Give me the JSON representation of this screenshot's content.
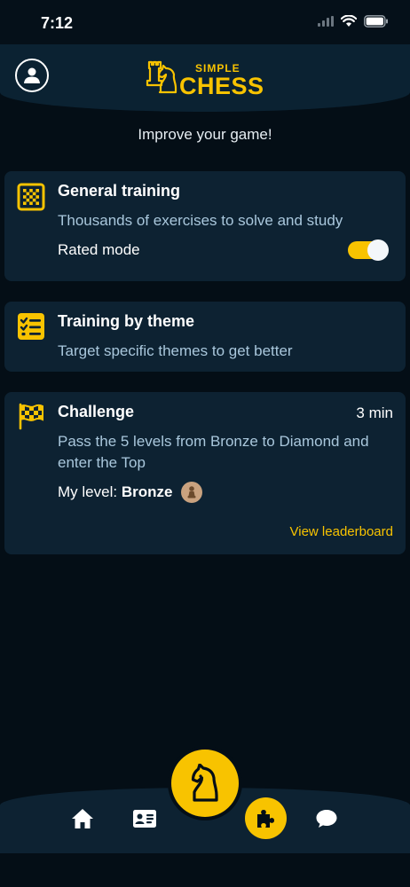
{
  "status_bar": {
    "time": "7:12",
    "icons": [
      "signal-icon",
      "wifi-icon",
      "battery-icon"
    ]
  },
  "header": {
    "logo_small": "SIMPLE",
    "logo_big": "CHESS",
    "profile_icon": "user-circle-icon"
  },
  "tagline": "Improve your game!",
  "cards": {
    "general": {
      "icon": "checkerboard-icon",
      "title": "General training",
      "subtitle": "Thousands of exercises to solve and study",
      "toggle_label": "Rated mode",
      "toggle_on": true
    },
    "theme": {
      "icon": "checklist-icon",
      "title": "Training by theme",
      "subtitle": "Target specific themes to get better"
    },
    "challenge": {
      "icon": "checkered-flag-icon",
      "title": "Challenge",
      "duration": "3 min",
      "subtitle": "Pass the 5 levels from Bronze to Diamond and enter the Top",
      "level_label": "My level:",
      "level_value": "Bronze",
      "level_badge_icon": "bronze-pawn-badge-icon",
      "link": "View leaderboard"
    }
  },
  "bottom_nav": {
    "items": [
      "home-icon",
      "id-card-icon",
      "knight-icon",
      "puzzle-icon",
      "chat-bubble-icon"
    ],
    "active": "puzzle-icon"
  },
  "colors": {
    "background": "#040e16",
    "card": "#0d2232",
    "accent": "#f8c300",
    "subtitle": "#a9c7dc"
  }
}
